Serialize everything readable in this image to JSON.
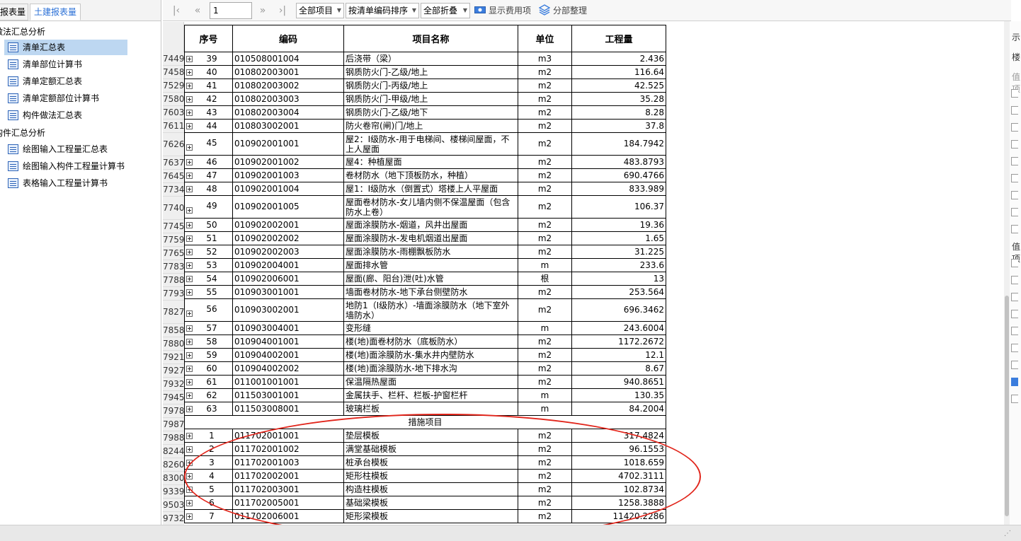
{
  "left_panel": {
    "tabs": [
      "报表量",
      "土建报表量"
    ],
    "groups": [
      {
        "label": "做法汇总分析",
        "items": [
          {
            "label": "清单汇总表",
            "selected": true
          },
          {
            "label": "清单部位计算书",
            "selected": false
          },
          {
            "label": "清单定额汇总表",
            "selected": false
          },
          {
            "label": "清单定额部位计算书",
            "selected": false
          },
          {
            "label": "构件做法汇总表",
            "selected": false
          }
        ]
      },
      {
        "label": "构件汇总分析",
        "items": [
          {
            "label": "绘图输入工程量汇总表",
            "selected": false
          },
          {
            "label": "绘图输入构件工程量计算书",
            "selected": false
          },
          {
            "label": "表格输入工程量计算书",
            "selected": false
          }
        ]
      }
    ]
  },
  "toolbar": {
    "page_value": "1",
    "scope_select": "全部项目",
    "sort_select": "按清单编码排序",
    "fold_select": "全部折叠",
    "show_fee_label": "显示费用项",
    "section_sort_label": "分部整理"
  },
  "table": {
    "headers": [
      "序号",
      "编码",
      "项目名称",
      "单位",
      "工程量"
    ],
    "rows": [
      {
        "row": "7449",
        "no": "39",
        "code": "010508001004",
        "name": "后浇带（梁）",
        "unit": "m3",
        "qty": "2.436"
      },
      {
        "row": "7458",
        "no": "40",
        "code": "010802003001",
        "name": "钢质防火门-乙级/地上",
        "unit": "m2",
        "qty": "116.64"
      },
      {
        "row": "7529",
        "no": "41",
        "code": "010802003002",
        "name": "钢质防火门-丙级/地上",
        "unit": "m2",
        "qty": "42.525"
      },
      {
        "row": "7580",
        "no": "42",
        "code": "010802003003",
        "name": "钢质防火门-甲级/地上",
        "unit": "m2",
        "qty": "35.28"
      },
      {
        "row": "7603",
        "no": "43",
        "code": "010802003004",
        "name": "钢质防火门-乙级/地下",
        "unit": "m2",
        "qty": "8.28"
      },
      {
        "row": "7611",
        "no": "44",
        "code": "010803002001",
        "name": "防火卷帘(闸)门/地上",
        "unit": "m2",
        "qty": "37.8"
      },
      {
        "row": "7626",
        "no": "45",
        "code": "010902001001",
        "name": "屋2：Ⅰ级防水-用于电梯间、楼梯间屋面，不上人屋面",
        "unit": "m2",
        "qty": "184.7942",
        "tall": true
      },
      {
        "row": "7637",
        "no": "46",
        "code": "010902001002",
        "name": "屋4：种植屋面",
        "unit": "m2",
        "qty": "483.8793"
      },
      {
        "row": "7645",
        "no": "47",
        "code": "010902001003",
        "name": "卷材防水（地下顶板防水，种植）",
        "unit": "m2",
        "qty": "690.4766"
      },
      {
        "row": "7734",
        "no": "48",
        "code": "010902001004",
        "name": "屋1：Ⅰ级防水（倒置式）塔楼上人平屋面",
        "unit": "m2",
        "qty": "833.989"
      },
      {
        "row": "7740",
        "no": "49",
        "code": "010902001005",
        "name": "屋面卷材防水-女儿墙内侧不保温屋面（包含防水上卷）",
        "unit": "m2",
        "qty": "106.37",
        "tall": true
      },
      {
        "row": "7745",
        "no": "50",
        "code": "010902002001",
        "name": "屋面涂膜防水-烟道，风井出屋面",
        "unit": "m2",
        "qty": "19.36"
      },
      {
        "row": "7759",
        "no": "51",
        "code": "010902002002",
        "name": "屋面涂膜防水-发电机烟道出屋面",
        "unit": "m2",
        "qty": "1.65"
      },
      {
        "row": "7765",
        "no": "52",
        "code": "010902002003",
        "name": "屋面涂膜防水-雨棚飘板防水",
        "unit": "m2",
        "qty": "31.225"
      },
      {
        "row": "7783",
        "no": "53",
        "code": "010902004001",
        "name": "屋面排水管",
        "unit": "m",
        "qty": "233.6"
      },
      {
        "row": "7788",
        "no": "54",
        "code": "010902006001",
        "name": "屋面(廊、阳台)泄(吐)水管",
        "unit": "根",
        "qty": "13"
      },
      {
        "row": "7793",
        "no": "55",
        "code": "010903001001",
        "name": "墙面卷材防水-地下承台侧壁防水",
        "unit": "m2",
        "qty": "253.564"
      },
      {
        "row": "7827",
        "no": "56",
        "code": "010903002001",
        "name": "地防1（Ⅰ级防水）-墙面涂膜防水（地下室外墙防水）",
        "unit": "m2",
        "qty": "696.3462",
        "tall": true
      },
      {
        "row": "7858",
        "no": "57",
        "code": "010903004001",
        "name": "变形缝",
        "unit": "m",
        "qty": "243.6004"
      },
      {
        "row": "7880",
        "no": "58",
        "code": "010904001001",
        "name": "楼(地)面卷材防水（底板防水）",
        "unit": "m2",
        "qty": "1172.2672"
      },
      {
        "row": "7921",
        "no": "59",
        "code": "010904002001",
        "name": "楼(地)面涂膜防水-集水井内壁防水",
        "unit": "m2",
        "qty": "12.1"
      },
      {
        "row": "7927",
        "no": "60",
        "code": "010904002002",
        "name": "楼(地)面涂膜防水-地下排水沟",
        "unit": "m2",
        "qty": "8.67"
      },
      {
        "row": "7932",
        "no": "61",
        "code": "011001001001",
        "name": "保温隔热屋面",
        "unit": "m2",
        "qty": "940.8651"
      },
      {
        "row": "7945",
        "no": "62",
        "code": "011503001001",
        "name": "金属扶手、栏杆、栏板-护窗栏杆",
        "unit": "m",
        "qty": "130.35"
      },
      {
        "row": "7978",
        "no": "63",
        "code": "011503008001",
        "name": "玻璃栏板",
        "unit": "m",
        "qty": "84.2004"
      },
      {
        "row": "7987",
        "section": "措施项目"
      },
      {
        "row": "7988",
        "no": "1",
        "code": "011702001001",
        "name": "垫层模板",
        "unit": "m2",
        "qty": "317.4824"
      },
      {
        "row": "8244",
        "no": "2",
        "code": "011702001002",
        "name": "满堂基础模板",
        "unit": "m2",
        "qty": "96.1553"
      },
      {
        "row": "8260",
        "no": "3",
        "code": "011702001003",
        "name": "桩承台模板",
        "unit": "m2",
        "qty": "1018.659"
      },
      {
        "row": "8300",
        "no": "4",
        "code": "011702002001",
        "name": "矩形柱模板",
        "unit": "m2",
        "qty": "4702.3111"
      },
      {
        "row": "9339",
        "no": "5",
        "code": "011702003001",
        "name": "构造柱模板",
        "unit": "m2",
        "qty": "102.8734"
      },
      {
        "row": "9503",
        "no": "6",
        "code": "011702005001",
        "name": "基础梁模板",
        "unit": "m2",
        "qty": "1258.3888"
      },
      {
        "row": "9732",
        "no": "7",
        "code": "011702006001",
        "name": "矩形梁模板",
        "unit": "m2",
        "qty": "11420.2286"
      }
    ]
  },
  "right_panel": {
    "texts": [
      "示",
      "楼",
      "值项",
      "值项"
    ]
  },
  "colors": {
    "selection": "#bdd7f1",
    "accent_tab": "#2a6fd6",
    "annotation_oval": "#e1251b"
  }
}
